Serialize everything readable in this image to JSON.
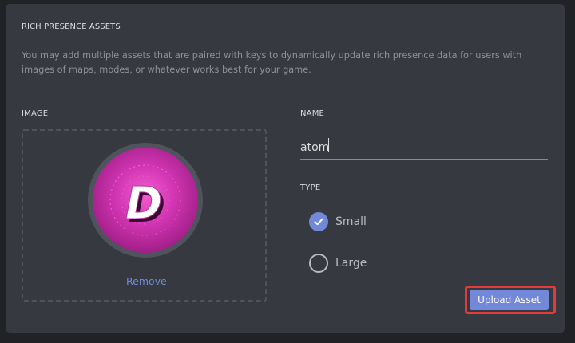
{
  "section": {
    "title": "RICH PRESENCE ASSETS",
    "description": "You may add multiple assets that are paired with keys to dynamically update rich presence data for users with images of maps, modes, or whatever works best for your game."
  },
  "image": {
    "label": "IMAGE",
    "remove_label": "Remove",
    "avatar_letter": "D"
  },
  "name": {
    "label": "NAME",
    "value": "atom"
  },
  "type": {
    "label": "TYPE",
    "options": [
      {
        "label": "Small",
        "checked": true
      },
      {
        "label": "Large",
        "checked": false
      }
    ]
  },
  "upload": {
    "label": "Upload Asset"
  },
  "colors": {
    "accent": "#7289da",
    "highlight": "#e23b3b",
    "panel": "#36393f",
    "avatar": "#d537b5"
  }
}
